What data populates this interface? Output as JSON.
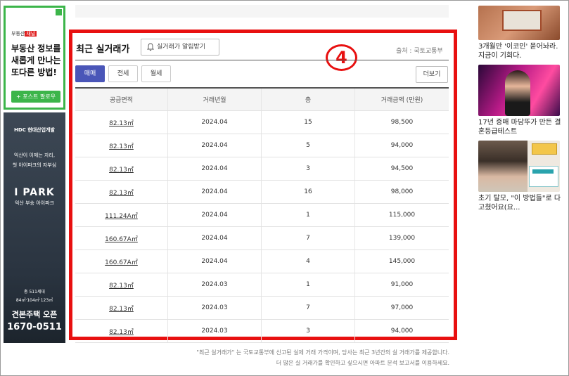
{
  "left_ads": {
    "top_ad": {
      "brand_prefix": "부동산",
      "brand_badge": "채널",
      "lines": [
        "부동산 정보를",
        "새롭게 만나는",
        "또다른 방법!"
      ],
      "follow_label": "+ 포스트 팔로우"
    },
    "dark_ad": {
      "maker": "HDC 현대산업개발",
      "loc1": "익산이 이제는 자리,",
      "loc2": "첫 아이파크의 자부심",
      "brand": "I PARK",
      "brand_sub": "익산 부송 아이파크",
      "units1": "총 511세대",
      "units2": "84㎡·104㎡·123㎡",
      "open": "견본주택 오픈",
      "phone": "1670-0511"
    }
  },
  "section": {
    "title": "최근 실거래가",
    "alert_label": "실거래가 알림받기",
    "source": "출처 : 국토교통부",
    "annotation_number": "4",
    "tabs": [
      {
        "label": "매매",
        "active": true
      },
      {
        "label": "전세",
        "active": false
      },
      {
        "label": "월세",
        "active": false
      }
    ],
    "more_label": "더보기"
  },
  "table": {
    "headers": [
      "공급면적",
      "거래년월",
      "층",
      "거래금액 (만원)"
    ],
    "rows": [
      {
        "area": "82.13㎡",
        "date": "2024.04",
        "floor": "15",
        "price": "98,500"
      },
      {
        "area": "82.13㎡",
        "date": "2024.04",
        "floor": "5",
        "price": "94,000"
      },
      {
        "area": "82.13㎡",
        "date": "2024.04",
        "floor": "3",
        "price": "94,500"
      },
      {
        "area": "82.13㎡",
        "date": "2024.04",
        "floor": "16",
        "price": "98,000"
      },
      {
        "area": "111.24A㎡",
        "date": "2024.04",
        "floor": "1",
        "price": "115,000"
      },
      {
        "area": "160.67A㎡",
        "date": "2024.04",
        "floor": "7",
        "price": "139,000"
      },
      {
        "area": "160.67A㎡",
        "date": "2024.04",
        "floor": "4",
        "price": "145,000"
      },
      {
        "area": "82.13㎡",
        "date": "2024.03",
        "floor": "1",
        "price": "91,000"
      },
      {
        "area": "82.13㎡",
        "date": "2024.03",
        "floor": "7",
        "price": "97,000"
      },
      {
        "area": "82.13㎡",
        "date": "2024.03",
        "floor": "3",
        "price": "94,000"
      }
    ]
  },
  "notes": {
    "line1": "\"최근 실거래가\" 는 국토교통부에 신고된 실제 거래 가격이며, 당사는 최근 3년간의 실 거래가를 제공합니다.",
    "line2": "더 많은 실 거래가를 확인하고 싶으시면 아파트 분석 보고서를 이용하세요."
  },
  "right_items": [
    {
      "caption": "3개월만 '이코인' 묻어놔라. 지금이 기회다."
    },
    {
      "caption": "17년 증매 마담뚜가 만든 결혼등급테스트"
    },
    {
      "caption": "초기 탈모, \"이 방법들\"로 다 고쳤어요(요..."
    }
  ],
  "colors": {
    "highlight_red": "#e81010",
    "active_tab": "#4a56b8",
    "ad_green": "#3cb54a"
  }
}
